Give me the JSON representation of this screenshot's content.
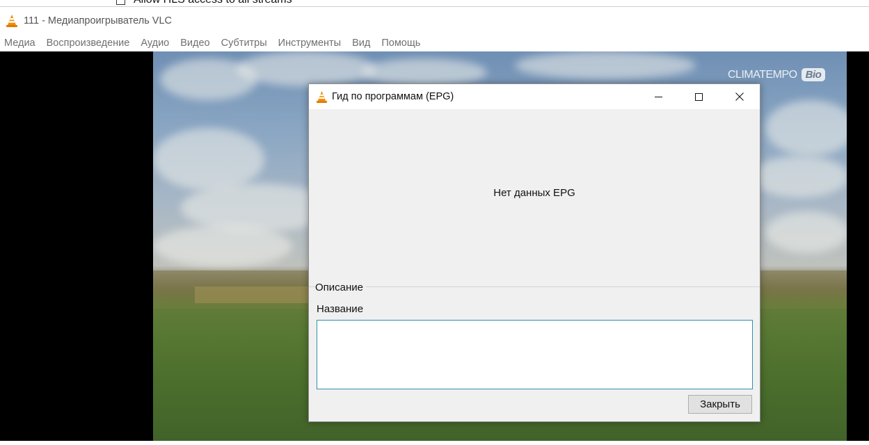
{
  "behind_window": {
    "checkbox_label": "Allow HLS access to all streams"
  },
  "window": {
    "title": "111 - Медиапроигрыватель VLC",
    "app_icon": "vlc-cone-icon"
  },
  "menu": {
    "items": [
      {
        "label": "Медиа"
      },
      {
        "label": "Воспроизведение"
      },
      {
        "label": "Аудио"
      },
      {
        "label": "Видео"
      },
      {
        "label": "Субтитры"
      },
      {
        "label": "Инструменты"
      },
      {
        "label": "Вид"
      },
      {
        "label": "Помощь"
      }
    ]
  },
  "video": {
    "watermark_text": "CLIMATEMPO",
    "watermark_badge": "Bio"
  },
  "epg_dialog": {
    "title": "Гид по программам (EPG)",
    "no_data_text": "Нет данных EPG",
    "description_group_label": "Описание",
    "name_label": "Название",
    "description_value": "",
    "close_button_label": "Закрыть",
    "controls": [
      "minimize-icon",
      "maximize-icon",
      "close-icon"
    ]
  },
  "colors": {
    "accent_border": "#2d8fa8",
    "vlc_orange": "#f48b00"
  }
}
